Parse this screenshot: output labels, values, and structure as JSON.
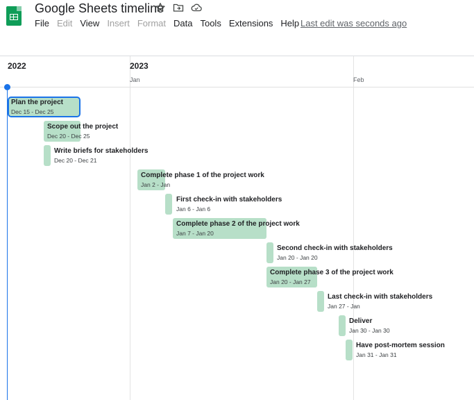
{
  "app": {
    "title": "Google Sheets timeline",
    "last_edit": "Last edit was seconds ago"
  },
  "menu": [
    {
      "label": "File",
      "enabled": true
    },
    {
      "label": "Edit",
      "enabled": false
    },
    {
      "label": "View",
      "enabled": true
    },
    {
      "label": "Insert",
      "enabled": false
    },
    {
      "label": "Format",
      "enabled": false
    },
    {
      "label": "Data",
      "enabled": true
    },
    {
      "label": "Tools",
      "enabled": true
    },
    {
      "label": "Extensions",
      "enabled": true
    },
    {
      "label": "Help",
      "enabled": true
    }
  ],
  "title_icons": [
    "star-icon",
    "move-folder-icon",
    "cloud-status-icon"
  ],
  "timeline": {
    "years": [
      "2022",
      "2023"
    ],
    "months": [
      "Jan",
      "Feb"
    ],
    "tasks": [
      {
        "name": "Plan the project",
        "dates": "Dec 15 - Dec 25",
        "selected": true
      },
      {
        "name": "Scope out the project",
        "dates": "Dec 20 - Dec 25",
        "selected": false
      },
      {
        "name": "Write briefs for stakeholders",
        "dates": "Dec 20 - Dec 21",
        "selected": false
      },
      {
        "name": "Complete phase 1 of the project work",
        "dates": "Jan 2 - Jan",
        "selected": false
      },
      {
        "name": "First check-in with stakeholders",
        "dates": "Jan 6 - Jan 6",
        "selected": false
      },
      {
        "name": "Complete phase 2 of the project work",
        "dates": "Jan 7 - Jan 20",
        "selected": false
      },
      {
        "name": "Second check-in with stakeholders",
        "dates": "Jan 20 - Jan 20",
        "selected": false
      },
      {
        "name": "Complete phase 3 of the project work",
        "dates": "Jan 20 - Jan 27",
        "selected": false
      },
      {
        "name": "Last check-in with stakeholders",
        "dates": "Jan 27 - Jan",
        "selected": false
      },
      {
        "name": "Deliver",
        "dates": "Jan 30 - Jan 30",
        "selected": false
      },
      {
        "name": "Have post-mortem session",
        "dates": "Jan 31 - Jan 31",
        "selected": false
      }
    ]
  },
  "colors": {
    "task_bar": "#b7dfc8",
    "selection": "#1a73e8",
    "brand": "#0f9d58"
  }
}
